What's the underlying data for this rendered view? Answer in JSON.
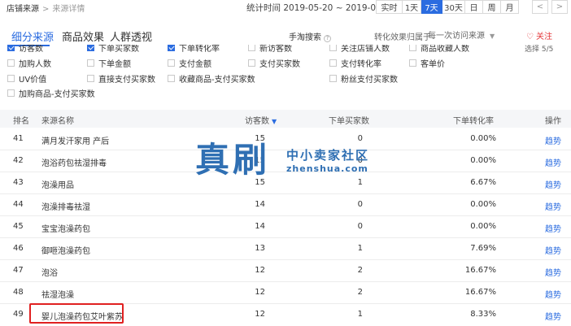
{
  "breadcrumb": {
    "parent": "店铺来源",
    "separator": ">",
    "current": "来源详情"
  },
  "stat_period": "统计时间 2019-05-20 ~ 2019-05-26",
  "range_buttons": [
    "实时",
    "1天",
    "7天",
    "30天",
    "日",
    "周",
    "月"
  ],
  "range_active": "7天",
  "nav": {
    "prev": "<",
    "next": ">"
  },
  "tabs": [
    "细分来源",
    "商品效果",
    "人群透视"
  ],
  "tab_active": "细分来源",
  "search_filter_label": "手淘搜索",
  "belong_label": "转化效果归属于",
  "belong_value": "每一次访问来源",
  "follow_label": "关注",
  "selected_count": "选择 5/5",
  "metrics": [
    {
      "label": "访客数",
      "checked": true
    },
    {
      "label": "下单买家数",
      "checked": true
    },
    {
      "label": "下单转化率",
      "checked": true
    },
    {
      "label": "新访客数",
      "checked": false
    },
    {
      "label": "关注店铺人数",
      "checked": false
    },
    {
      "label": "商品收藏人数",
      "checked": false
    },
    {
      "label": "加购人数",
      "checked": false
    },
    {
      "label": "下单金额",
      "checked": false
    },
    {
      "label": "支付金额",
      "checked": false
    },
    {
      "label": "支付买家数",
      "checked": false
    },
    {
      "label": "支付转化率",
      "checked": false
    },
    {
      "label": "客单价",
      "checked": false
    },
    {
      "label": "UV价值",
      "checked": false
    },
    {
      "label": "直接支付买家数",
      "checked": false
    },
    {
      "label": "收藏商品-支付买家数",
      "checked": false
    },
    {
      "label": "粉丝支付买家数",
      "checked": false
    },
    {
      "label": "加购商品-支付买家数",
      "checked": false
    }
  ],
  "table": {
    "headers": {
      "rank": "排名",
      "name": "来源名称",
      "uv": "访客数",
      "buyers": "下单买家数",
      "rate": "下单转化率",
      "op": "操作"
    },
    "rows": [
      {
        "rank": "41",
        "name": "满月发汗家用 产后",
        "uv": "15",
        "buyers": "0",
        "rate": "0.00%",
        "op": "趋势"
      },
      {
        "rank": "42",
        "name": "泡浴药包祛湿排毒",
        "uv": "15",
        "buyers": "0",
        "rate": "0.00%",
        "op": "趋势"
      },
      {
        "rank": "43",
        "name": "泡澡用品",
        "uv": "15",
        "buyers": "1",
        "rate": "6.67%",
        "op": "趋势"
      },
      {
        "rank": "44",
        "name": "泡澡排毒祛湿",
        "uv": "14",
        "buyers": "0",
        "rate": "0.00%",
        "op": "趋势"
      },
      {
        "rank": "45",
        "name": "宝宝泡澡药包",
        "uv": "14",
        "buyers": "0",
        "rate": "0.00%",
        "op": "趋势"
      },
      {
        "rank": "46",
        "name": "御咂泡澡药包",
        "uv": "13",
        "buyers": "1",
        "rate": "7.69%",
        "op": "趋势"
      },
      {
        "rank": "47",
        "name": "泡浴",
        "uv": "12",
        "buyers": "2",
        "rate": "16.67%",
        "op": "趋势"
      },
      {
        "rank": "48",
        "name": "祛湿泡澡",
        "uv": "12",
        "buyers": "2",
        "rate": "16.67%",
        "op": "趋势"
      },
      {
        "rank": "49",
        "name": "婴儿泡澡药包艾叶紫苏",
        "uv": "12",
        "buyers": "1",
        "rate": "8.33%",
        "op": "趋势"
      }
    ]
  },
  "watermark": {
    "big": "真刷",
    "cn": "中小卖家社区",
    "en": "zhenshua.com"
  },
  "colors": {
    "accent": "#2b6ce0",
    "highlight": "#e02020",
    "watermark": "#2f6fb3",
    "follow": "#e4393c"
  }
}
